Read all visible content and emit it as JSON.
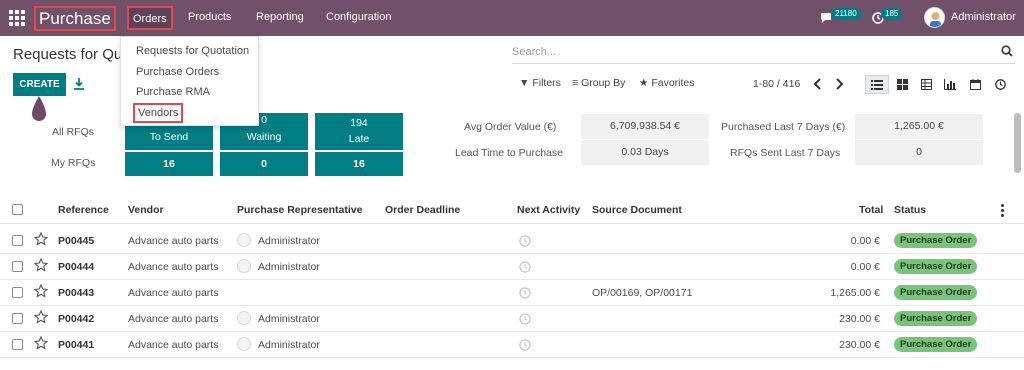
{
  "navbar": {
    "app_name": "Purchase",
    "menus": [
      "Orders",
      "Products",
      "Reporting",
      "Configuration"
    ],
    "messages_count": "21180",
    "activities_count": "185",
    "user_name": "Administrator"
  },
  "orders_menu": {
    "items": [
      "Requests for Quotation",
      "Purchase Orders",
      "Purchase RMA",
      "Vendors"
    ]
  },
  "control": {
    "page_title": "Requests for Quo",
    "search_placeholder": "Search...",
    "create_label": "CREATE",
    "filters_label": "Filters",
    "groupby_label": "Group By",
    "favorites_label": "Favorites",
    "pager": "1-80 / 416"
  },
  "dashboard": {
    "all_rfqs_label": "All RFQs",
    "my_rfqs_label": "My RFQs",
    "tiles": [
      {
        "top": "",
        "label": "To Send",
        "my": "16"
      },
      {
        "top": "0",
        "label": "Waiting",
        "my": "0"
      },
      {
        "top": "194",
        "label": "Late",
        "my": "16"
      }
    ],
    "stats": {
      "avg_order_value_label": "Avg Order Value (€)",
      "avg_order_value": "6,709,938.54 €",
      "purchased_7d_label": "Purchased Last 7 Days (€)",
      "purchased_7d": "1,265.00 €",
      "lead_time_label": "Lead Time to Purchase",
      "lead_time": "0.03  Days",
      "rfqs_sent_label": "RFQs Sent Last 7 Days",
      "rfqs_sent": "0"
    }
  },
  "table": {
    "columns": [
      "Reference",
      "Vendor",
      "Purchase Representative",
      "Order Deadline",
      "Next Activity",
      "Source Document",
      "Total",
      "Status"
    ],
    "rows": [
      {
        "reference": "P00445",
        "vendor": "Advance auto parts",
        "rep": "Administrator",
        "source": "",
        "total": "0.00 €",
        "status": "Purchase Order"
      },
      {
        "reference": "P00444",
        "vendor": "Advance auto parts",
        "rep": "Administrator",
        "source": "",
        "total": "0.00 €",
        "status": "Purchase Order"
      },
      {
        "reference": "P00443",
        "vendor": "Advance auto parts",
        "rep": "",
        "source": "OP/00169, OP/00171",
        "total": "1,265.00 €",
        "status": "Purchase Order"
      },
      {
        "reference": "P00442",
        "vendor": "Advance auto parts",
        "rep": "Administrator",
        "source": "",
        "total": "230.00 €",
        "status": "Purchase Order"
      },
      {
        "reference": "P00441",
        "vendor": "Advance auto parts",
        "rep": "Administrator",
        "source": "",
        "total": "230.00 €",
        "status": "Purchase Order"
      }
    ]
  },
  "colors": {
    "navbar": "#71506a",
    "primary": "#017e84",
    "status_badge": "#79c47a",
    "highlight_box": "#e04a4a"
  },
  "icons": [
    "apps-grid-icon",
    "chat-icon",
    "activity-clock-icon",
    "search-icon",
    "download-icon",
    "chevron-left-icon",
    "chevron-right-icon",
    "list-view-icon",
    "kanban-view-icon",
    "pivot-view-icon",
    "graph-view-icon",
    "calendar-view-icon",
    "activity-view-icon",
    "star-icon",
    "clock-icon",
    "kebab-icon"
  ]
}
